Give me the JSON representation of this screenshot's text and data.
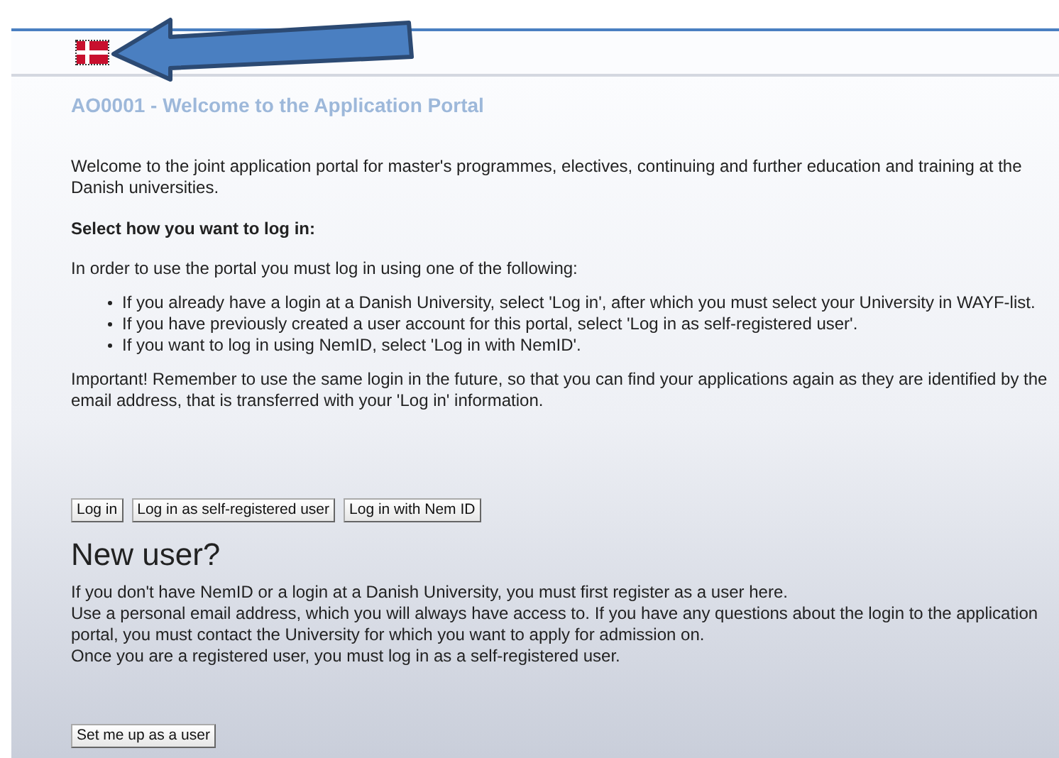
{
  "page_title": "AO0001 - Welcome to the Application Portal",
  "intro": "Welcome to the joint application portal for master's programmes, electives, continuing and further education and training at the Danish universities.",
  "login_heading": "Select how you want to log in:",
  "login_lead": "In order to use the portal you must log in using one of the following:",
  "login_options": [
    "If you already have a login at a Danish University, select 'Log in', after which you must select your University in WAYF-list.",
    "If you have previously created a user account for this portal, select 'Log in as self-registered user'.",
    "If you want to log in using NemID, select 'Log in with NemID'."
  ],
  "important": "Important! Remember to use the same login in the future, so that you can find your applications again as they are identified by the email address, that is transferred with your 'Log in' information.",
  "login_buttons": [
    "Log in",
    "Log in as self-registered user",
    "Log in with Nem ID"
  ],
  "new_user_heading": "New user?",
  "new_user_lines": [
    "If you don't have NemID or a login at a Danish University, you must first register as a user here.",
    "Use a personal email address, which you will always have access to. If you have any questions about the login to the application portal, you must contact the University for which you want to apply for admission on.",
    "Once you are a registered user, you must log in as a self-registered user."
  ],
  "register_button": "Set me up as a user"
}
